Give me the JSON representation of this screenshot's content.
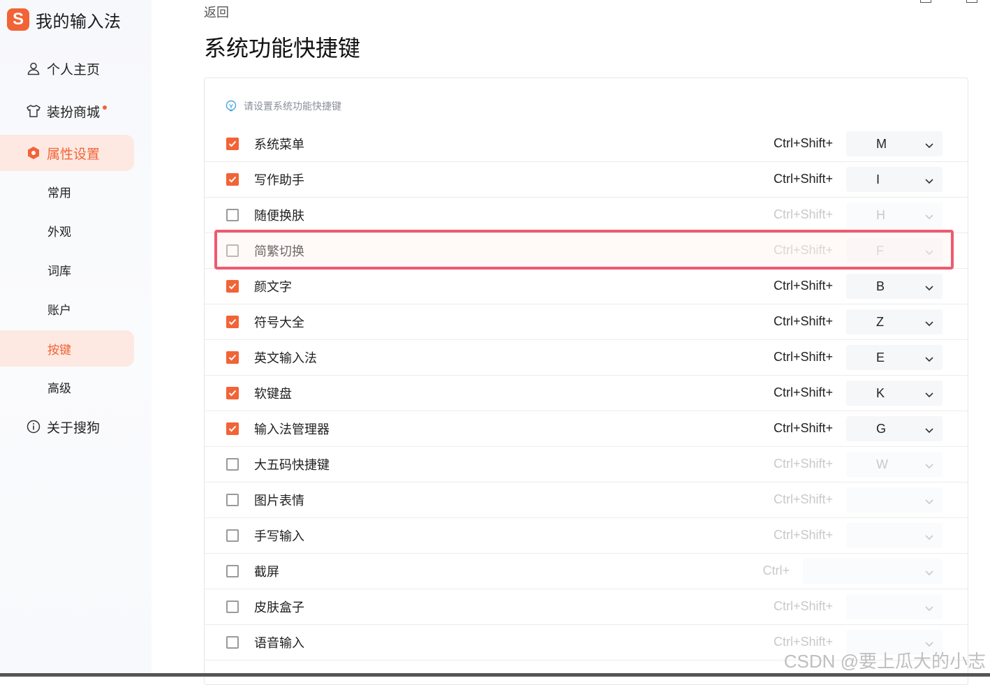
{
  "app": {
    "logo_letter": "S",
    "title": "我的输入法"
  },
  "sidebar": {
    "items": [
      {
        "label": "个人主页",
        "icon": "person-icon"
      },
      {
        "label": "装扮商城",
        "icon": "shirt-icon",
        "has_dot": true
      },
      {
        "label": "属性设置",
        "icon": "settings-hexagon-icon",
        "active": true
      },
      {
        "label": "关于搜狗",
        "icon": "info-icon"
      }
    ],
    "sub_items": [
      "常用",
      "外观",
      "词库",
      "账户",
      "按键",
      "高级"
    ],
    "active_sub": "按键"
  },
  "header": {
    "back_label": "返回",
    "title": "系统功能快捷键"
  },
  "panel": {
    "hint": "请设置系统功能快捷键",
    "rows": [
      {
        "label": "系统菜单",
        "checked": true,
        "prefix": "Ctrl+Shift+",
        "key": "M"
      },
      {
        "label": "写作助手",
        "checked": true,
        "prefix": "Ctrl+Shift+",
        "key": "I"
      },
      {
        "label": "随便换肤",
        "checked": false,
        "prefix": "Ctrl+Shift+",
        "key": "H"
      },
      {
        "label": "简繁切换",
        "checked": false,
        "prefix": "Ctrl+Shift+",
        "key": "F",
        "highlighted": true
      },
      {
        "label": "颜文字",
        "checked": true,
        "prefix": "Ctrl+Shift+",
        "key": "B"
      },
      {
        "label": "符号大全",
        "checked": true,
        "prefix": "Ctrl+Shift+",
        "key": "Z"
      },
      {
        "label": "英文输入法",
        "checked": true,
        "prefix": "Ctrl+Shift+",
        "key": "E"
      },
      {
        "label": "软键盘",
        "checked": true,
        "prefix": "Ctrl+Shift+",
        "key": "K"
      },
      {
        "label": "输入法管理器",
        "checked": true,
        "prefix": "Ctrl+Shift+",
        "key": "G"
      },
      {
        "label": "大五码快捷键",
        "checked": false,
        "prefix": "Ctrl+Shift+",
        "key": "W"
      },
      {
        "label": "图片表情",
        "checked": false,
        "prefix": "Ctrl+Shift+",
        "key": ""
      },
      {
        "label": "手写输入",
        "checked": false,
        "prefix": "Ctrl+Shift+",
        "key": ""
      },
      {
        "label": "截屏",
        "checked": false,
        "prefix": "Ctrl+",
        "key": "",
        "wide": true
      },
      {
        "label": "皮肤盒子",
        "checked": false,
        "prefix": "Ctrl+Shift+",
        "key": ""
      },
      {
        "label": "语音输入",
        "checked": false,
        "prefix": "Ctrl+Shift+",
        "key": ""
      }
    ]
  },
  "watermark": "CSDN @要上瓜大的小志",
  "colors": {
    "accent": "#f26336",
    "highlight_border": "#ef5a6f"
  }
}
